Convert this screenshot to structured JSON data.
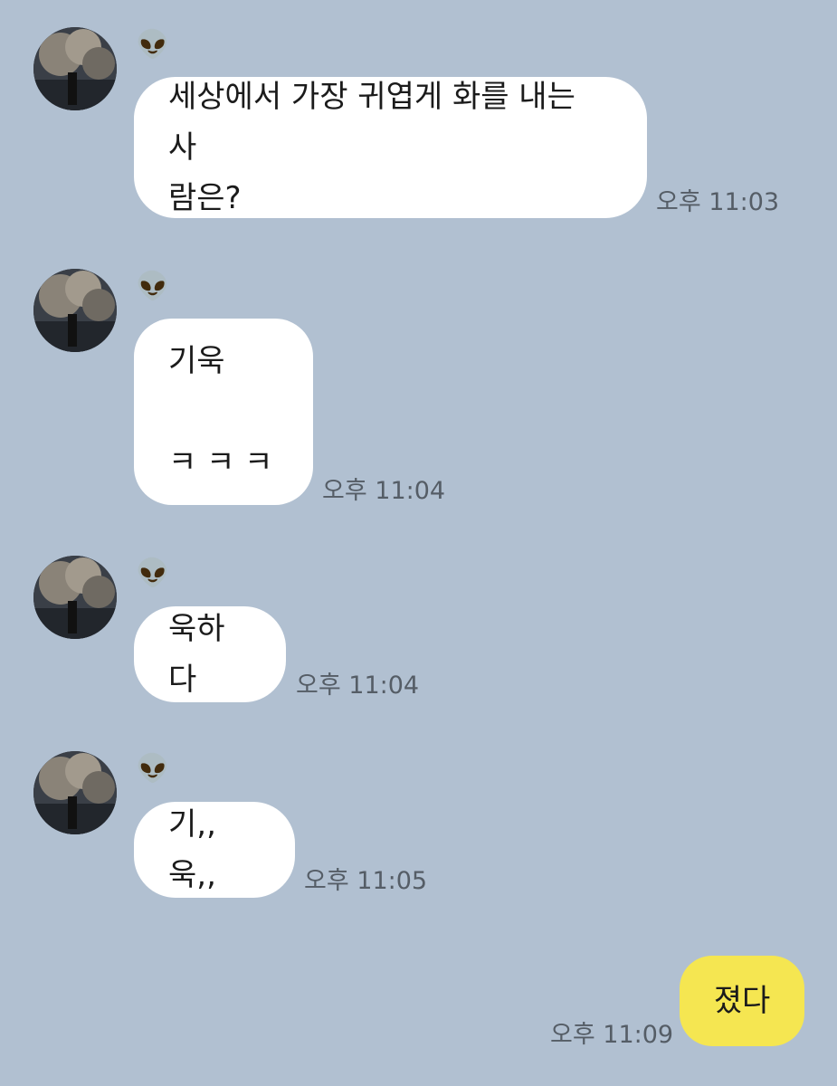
{
  "chat": {
    "messages": [
      {
        "sender_icon": "alien-emoji",
        "sender_glyph": "👽",
        "text": "세상에서 가장 귀엽게 화를 내는 사\n람은?",
        "time": "오후 11:03"
      },
      {
        "sender_icon": "alien-emoji",
        "sender_glyph": "👽",
        "text": "기욱\n\nㅋ ㅋ ㅋ",
        "time": "오후 11:04"
      },
      {
        "sender_icon": "alien-emoji",
        "sender_glyph": "👽",
        "text": "욱하다",
        "time": "오후 11:04"
      },
      {
        "sender_icon": "alien-emoji",
        "sender_glyph": "👽",
        "text": "기,,욱,,",
        "time": "오후 11:05"
      }
    ],
    "my_message": {
      "text": "졌다",
      "time": "오후 11:09"
    }
  },
  "colors": {
    "background": "#b1c0d1",
    "incoming_bubble": "#ffffff",
    "outgoing_bubble": "#f5e651",
    "time_text": "#555d66"
  }
}
